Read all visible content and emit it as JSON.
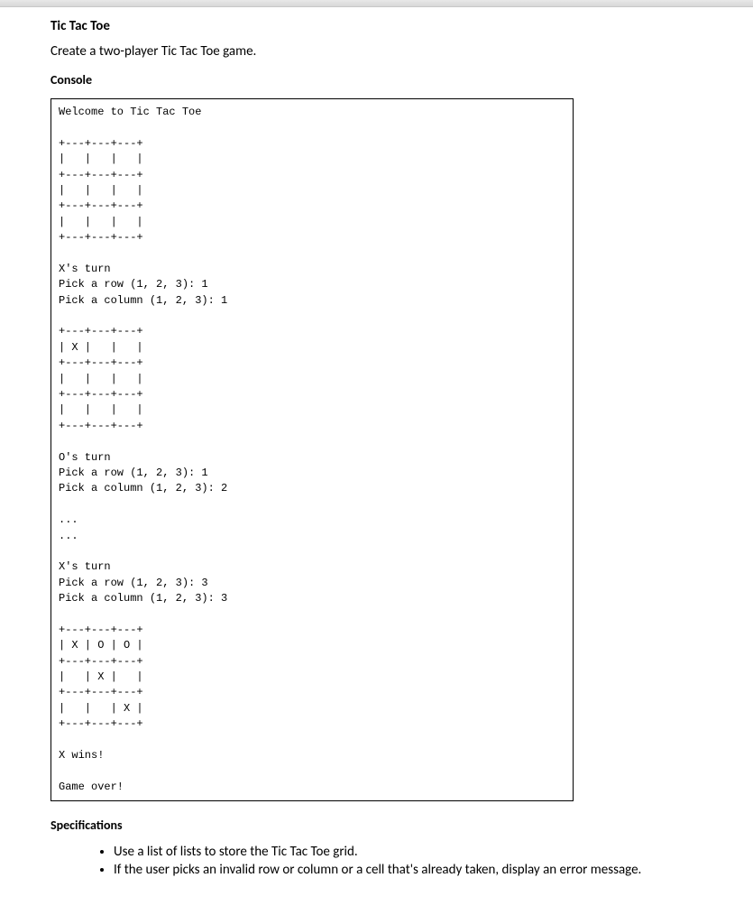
{
  "title": "Tic Tac Toe",
  "description": "Create a two-player Tic Tac Toe game.",
  "consoleHeading": "Console",
  "consoleOutput": "Welcome to Tic Tac Toe\n\n+---+---+---+\n|   |   |   |\n+---+---+---+\n|   |   |   |\n+---+---+---+\n|   |   |   |\n+---+---+---+\n\nX's turn\nPick a row (1, 2, 3): 1\nPick a column (1, 2, 3): 1\n\n+---+---+---+\n| X |   |   |\n+---+---+---+\n|   |   |   |\n+---+---+---+\n|   |   |   |\n+---+---+---+\n\nO's turn\nPick a row (1, 2, 3): 1\nPick a column (1, 2, 3): 2\n\n...\n...\n\nX's turn\nPick a row (1, 2, 3): 3\nPick a column (1, 2, 3): 3\n\n+---+---+---+\n| X | O | O |\n+---+---+---+\n|   | X |   |\n+---+---+---+\n|   |   | X |\n+---+---+---+\n\nX wins!\n\nGame over!",
  "specificationsHeading": "Specifications",
  "specifications": [
    "Use a list of lists to store the Tic Tac Toe grid.",
    "If the user picks an invalid row or column or a cell that's already taken, display an error message."
  ]
}
